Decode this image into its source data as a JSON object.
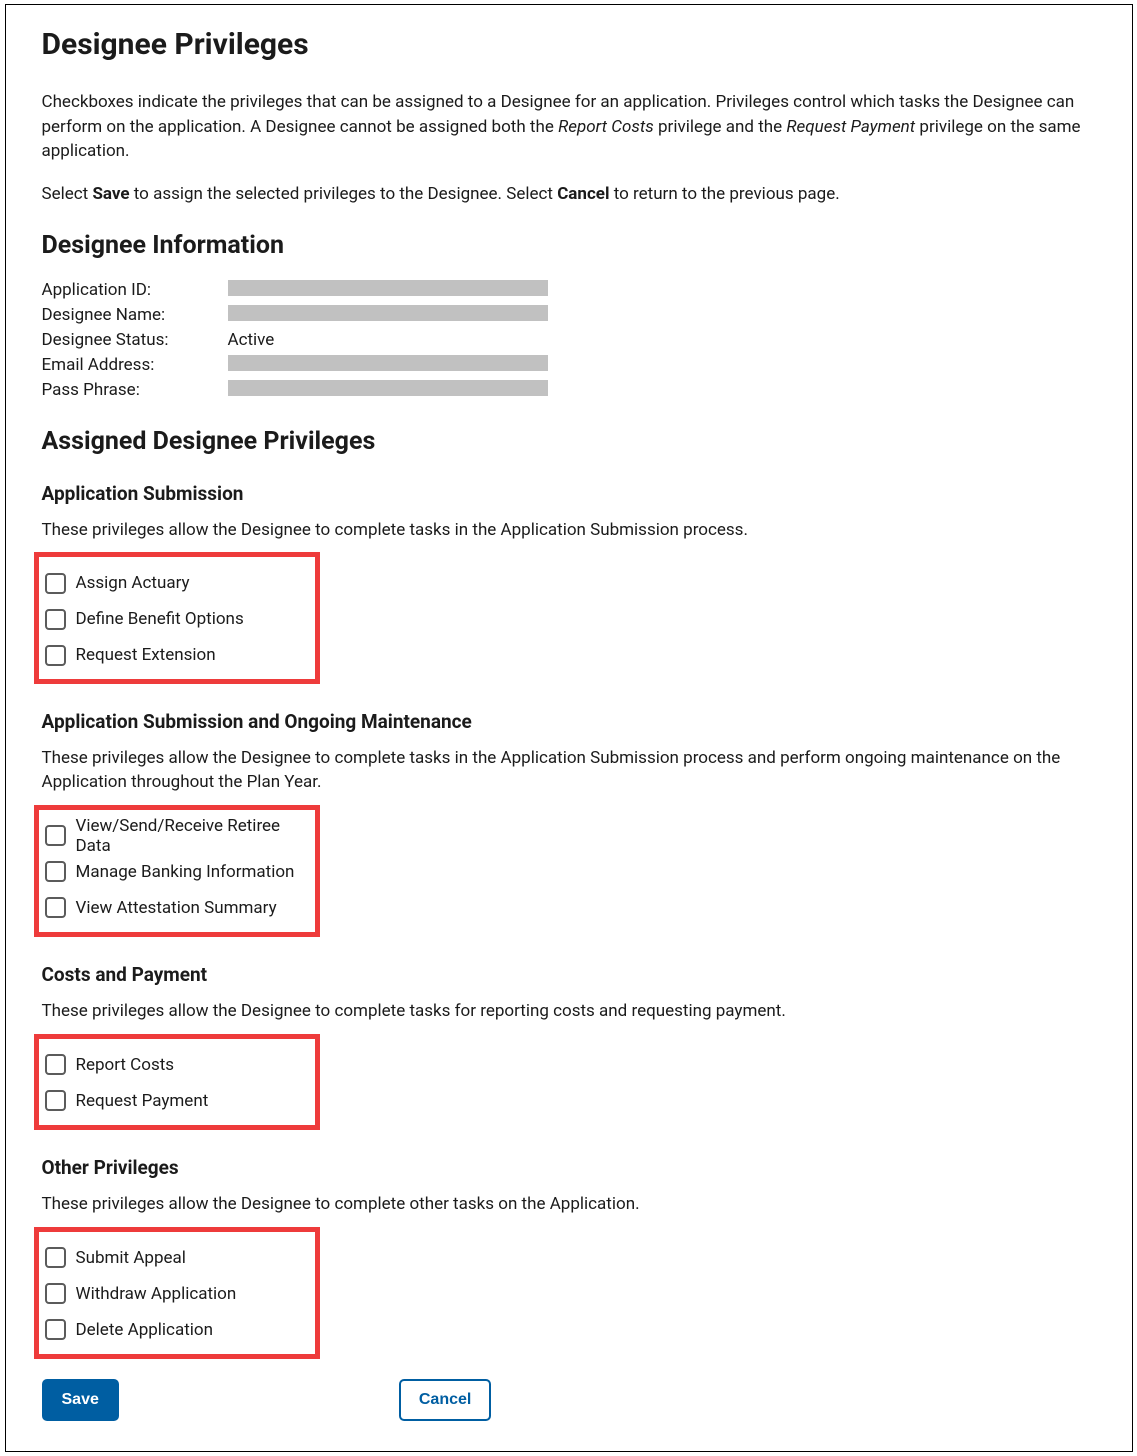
{
  "page_title": "Designee Privileges",
  "intro": {
    "p1_prefix": "Checkboxes indicate the privileges that can be assigned to a Designee for an application. Privileges control which tasks the Designee can perform on the application. A Designee cannot be assigned both the ",
    "p1_em1": "Report Costs",
    "p1_mid": " privilege and the ",
    "p1_em2": "Request Payment",
    "p1_suffix": " privilege on the same application.",
    "p2_prefix": "Select ",
    "p2_b1": "Save",
    "p2_mid": " to assign the selected privileges to the Designee. Select ",
    "p2_b2": "Cancel",
    "p2_suffix": " to return to the previous page."
  },
  "designee_info": {
    "heading": "Designee Information",
    "rows": {
      "app_id_label": "Application ID:",
      "name_label": "Designee Name:",
      "status_label": "Designee Status:",
      "status_value": "Active",
      "email_label": "Email Address:",
      "pass_label": "Pass Phrase:"
    }
  },
  "privileges": {
    "heading": "Assigned Designee Privileges",
    "groups": {
      "app_sub": {
        "title": "Application Submission",
        "desc": "These privileges allow the Designee to complete tasks in the Application Submission process.",
        "items": {
          "i0": "Assign Actuary",
          "i1": "Define Benefit Options",
          "i2": "Request Extension"
        }
      },
      "app_sub_maint": {
        "title": "Application Submission and Ongoing Maintenance",
        "desc": "These privileges allow the Designee to complete tasks in the Application Submission process and perform ongoing maintenance on the Application throughout the Plan Year.",
        "items": {
          "i0": "View/Send/Receive Retiree Data",
          "i1": "Manage Banking Information",
          "i2": "View Attestation Summary"
        }
      },
      "costs": {
        "title": "Costs and Payment",
        "desc": "These privileges allow the Designee to complete tasks for reporting costs and requesting payment.",
        "items": {
          "i0": "Report Costs",
          "i1": "Request Payment"
        }
      },
      "other": {
        "title": "Other Privileges",
        "desc": "These privileges allow the Designee to complete other tasks on the Application.",
        "items": {
          "i0": "Submit Appeal",
          "i1": "Withdraw Application",
          "i2": "Delete Application"
        }
      }
    }
  },
  "buttons": {
    "save": "Save",
    "cancel": "Cancel"
  }
}
